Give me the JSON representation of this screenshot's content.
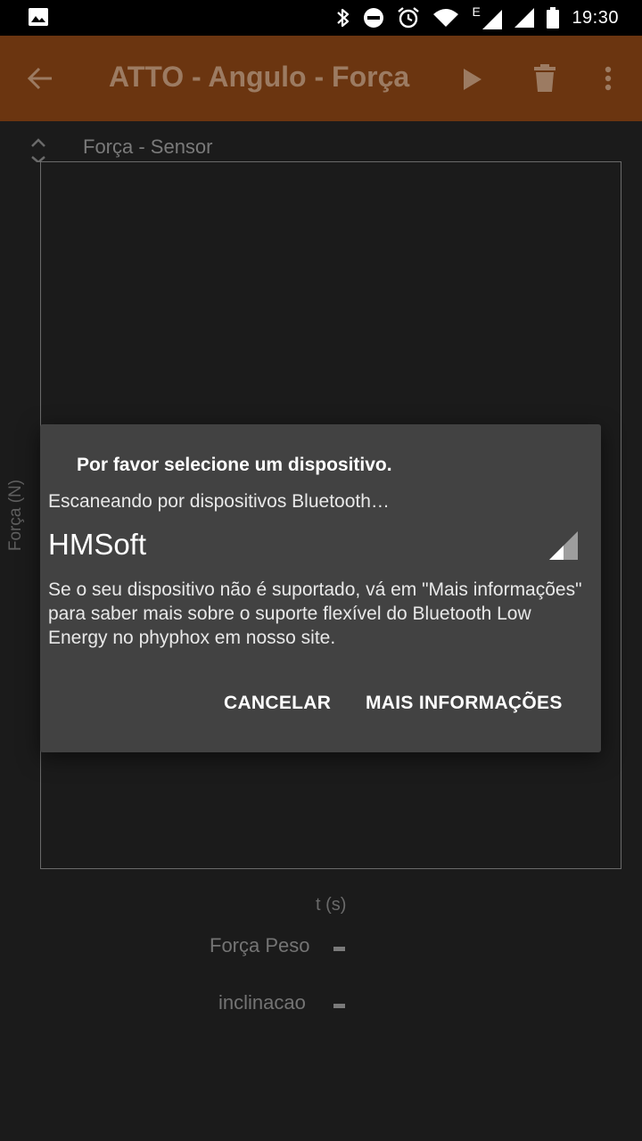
{
  "status_bar": {
    "time": "19:30",
    "network_type": "E",
    "icons": [
      "image-icon",
      "bluetooth-icon",
      "do-not-disturb-icon",
      "alarm-icon",
      "wifi-icon",
      "signal-icon",
      "signal-icon",
      "battery-icon"
    ]
  },
  "app_bar": {
    "title": "ATTO - Angulo - Força",
    "icons": [
      "back-arrow-icon",
      "play-icon",
      "delete-icon",
      "more-vert-icon"
    ]
  },
  "graph": {
    "title": "Força - Sensor",
    "y_label": "Força (N)",
    "x_label": "t (s)"
  },
  "values": [
    {
      "label": "Força Peso",
      "value": "-"
    },
    {
      "label": "inclinacao",
      "value": "-"
    }
  ],
  "dialog": {
    "title": "Por favor selecione um dispositivo.",
    "scanning_text": "Escaneando por dispositivos Bluetooth…",
    "devices": [
      {
        "name": "HMSoft",
        "signal_bars": 2,
        "signal_max": 4
      }
    ],
    "body": "Se o seu dispositivo não é suportado, vá em \"Mais informações\" para saber mais sobre o suporte flexível do Bluetooth Low Energy no phyphox em nosso site.",
    "cancel_label": "CANCELAR",
    "more_info_label": "MAIS INFORMAÇÕES"
  },
  "colors": {
    "app_bar": "#6b3510",
    "background": "#1b1b1b",
    "dialog": "#424242",
    "status_bar": "#000000"
  }
}
